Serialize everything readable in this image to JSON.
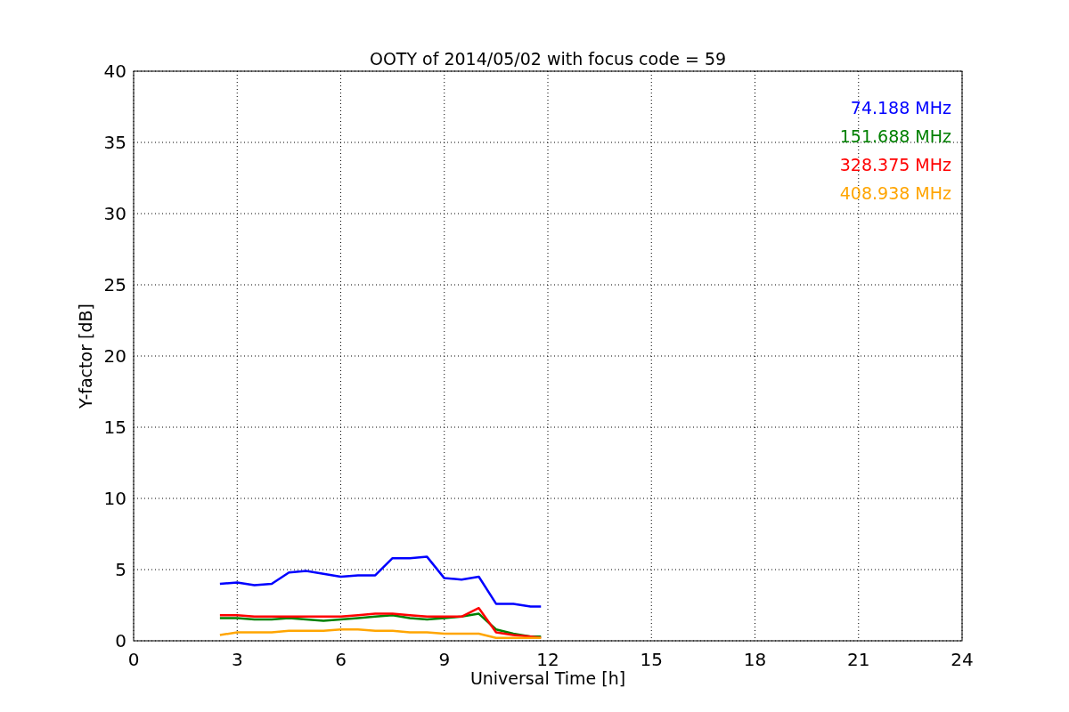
{
  "figure": {
    "chart_data": {
      "type": "line",
      "title": "OOTY of 2014/05/02 with focus code = 59",
      "xlabel": "Universal Time [h]",
      "ylabel": "Y-factor [dB]",
      "x": [
        2.5,
        3,
        3.5,
        4,
        4.5,
        5,
        5.5,
        6,
        6.5,
        7,
        7.5,
        8,
        8.5,
        9,
        9.5,
        10,
        10.5,
        11,
        11.5,
        11.8
      ],
      "series": [
        {
          "name": "74.188 MHz",
          "color": "#0000ff",
          "values": [
            4.0,
            4.1,
            3.9,
            4.0,
            4.8,
            4.9,
            4.7,
            4.5,
            4.6,
            4.6,
            5.8,
            5.8,
            5.9,
            4.4,
            4.3,
            4.5,
            2.6,
            2.6,
            2.4,
            2.4
          ]
        },
        {
          "name": "151.688 MHz",
          "color": "#008000",
          "values": [
            1.6,
            1.6,
            1.5,
            1.5,
            1.6,
            1.5,
            1.4,
            1.5,
            1.6,
            1.7,
            1.8,
            1.6,
            1.5,
            1.6,
            1.7,
            1.9,
            0.8,
            0.5,
            0.3,
            0.3
          ]
        },
        {
          "name": "328.375 MHz",
          "color": "#ff0000",
          "values": [
            1.8,
            1.8,
            1.7,
            1.7,
            1.7,
            1.7,
            1.7,
            1.7,
            1.8,
            1.9,
            1.9,
            1.8,
            1.7,
            1.7,
            1.7,
            2.3,
            0.6,
            0.4,
            0.3,
            0.2
          ]
        },
        {
          "name": "408.938 MHz",
          "color": "#ffa500",
          "values": [
            0.4,
            0.6,
            0.6,
            0.6,
            0.7,
            0.7,
            0.7,
            0.8,
            0.8,
            0.7,
            0.7,
            0.6,
            0.6,
            0.5,
            0.5,
            0.5,
            0.2,
            0.2,
            0.2,
            0.2
          ]
        }
      ],
      "xlim": [
        0,
        24
      ],
      "ylim": [
        0,
        40
      ],
      "xticks": [
        0,
        3,
        6,
        9,
        12,
        15,
        18,
        21,
        24
      ],
      "yticks": [
        0,
        5,
        10,
        15,
        20,
        25,
        30,
        35,
        40
      ],
      "grid": true
    }
  }
}
